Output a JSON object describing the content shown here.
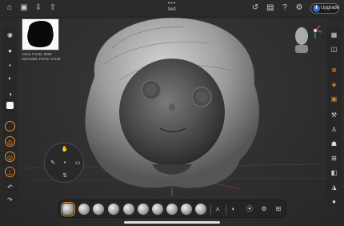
{
  "app": {
    "title": "test",
    "upgrade_label": "Upgrade"
  },
  "stats": {
    "active_points": "Active Points: 8066",
    "selectable_points": "Selectable Points: 57434"
  },
  "colors": {
    "accent": "#e58a2b",
    "panel": "#272727",
    "upgrade_icon": "#2f6fd6"
  },
  "topbar_icons_left": [
    "home-icon",
    "save-icon",
    "import-icon",
    "share-icon"
  ],
  "topbar_icons_right": [
    "history-icon",
    "folder-icon",
    "help-icon",
    "settings-icon"
  ],
  "left_tools": [
    "brush-size",
    "focal-shift",
    "draw-size",
    "material-sphere",
    "color-swatch",
    "stroke-mode",
    "symmetry",
    "mask",
    "undo",
    "redo"
  ],
  "right_tools": [
    "layers",
    "reference",
    "camera",
    "frame",
    "subdivide",
    "gizmo",
    "mesh",
    "tools",
    "transform",
    "light",
    "material"
  ],
  "bottom_brushes": [
    "standard",
    "clay",
    "clay-buildup",
    "move",
    "inflate",
    "smooth",
    "pinch",
    "dam-standard",
    "flatten",
    "trim"
  ],
  "bottom_icons": [
    "symmetry-icon",
    "mask-icon",
    "polygroup-icon",
    "settings-icon",
    "grid-icon"
  ]
}
